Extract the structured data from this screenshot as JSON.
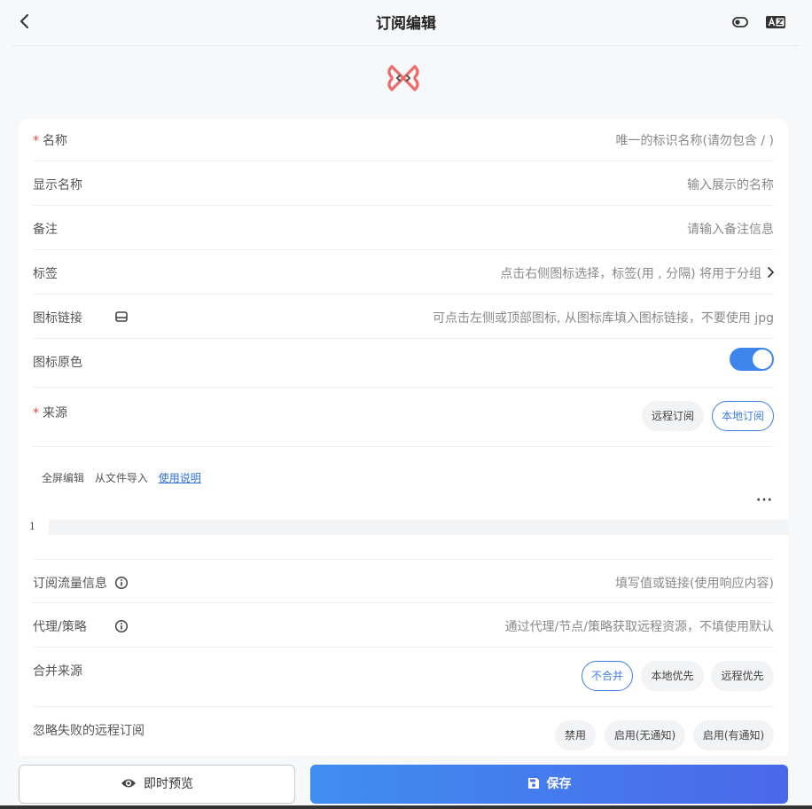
{
  "header": {
    "title": "订阅编辑"
  },
  "form": {
    "name": {
      "required_mark": "*",
      "label": "名称",
      "placeholder": "唯一的标识名称(请勿包含 / )"
    },
    "display_name": {
      "label": "显示名称",
      "placeholder": "输入展示的名称"
    },
    "remark": {
      "label": "备注",
      "placeholder": "请输入备注信息"
    },
    "tags": {
      "label": "标签",
      "placeholder": "点击右侧图标选择，标签(用 , 分隔) 将用于分组"
    },
    "icon_link": {
      "label": "图标链接",
      "placeholder": "可点击左侧或顶部图标, 从图标库填入图标链接，不要使用 jpg"
    },
    "icon_original_color": {
      "label": "图标原色",
      "enabled": true
    },
    "source": {
      "required_mark": "*",
      "label": "来源",
      "options": [
        "远程订阅",
        "本地订阅"
      ],
      "selected": "本地订阅"
    },
    "editor": {
      "fullscreen": "全屏编辑",
      "import_file": "从文件导入",
      "help": "使用说明",
      "more": "···",
      "line_number": "1"
    },
    "traffic_info": {
      "label": "订阅流量信息",
      "placeholder": "填写值或链接(使用响应内容)"
    },
    "proxy_policy": {
      "label": "代理/策略",
      "placeholder": "通过代理/节点/策略获取远程资源，不填使用默认"
    },
    "merge_source": {
      "label": "合并来源",
      "options": [
        "不合并",
        "本地优先",
        "远程优先"
      ],
      "selected": "不合并"
    },
    "ignore_failed": {
      "label": "忽略失败的远程订阅",
      "options": [
        "禁用",
        "启用(无通知)",
        "启用(有通知)"
      ]
    }
  },
  "footer": {
    "preview_label": "即时预览",
    "save_label": "保存"
  },
  "colors": {
    "accent": "#3d85ec",
    "required": "#e64a3b",
    "logo": "#ef6b6b"
  }
}
